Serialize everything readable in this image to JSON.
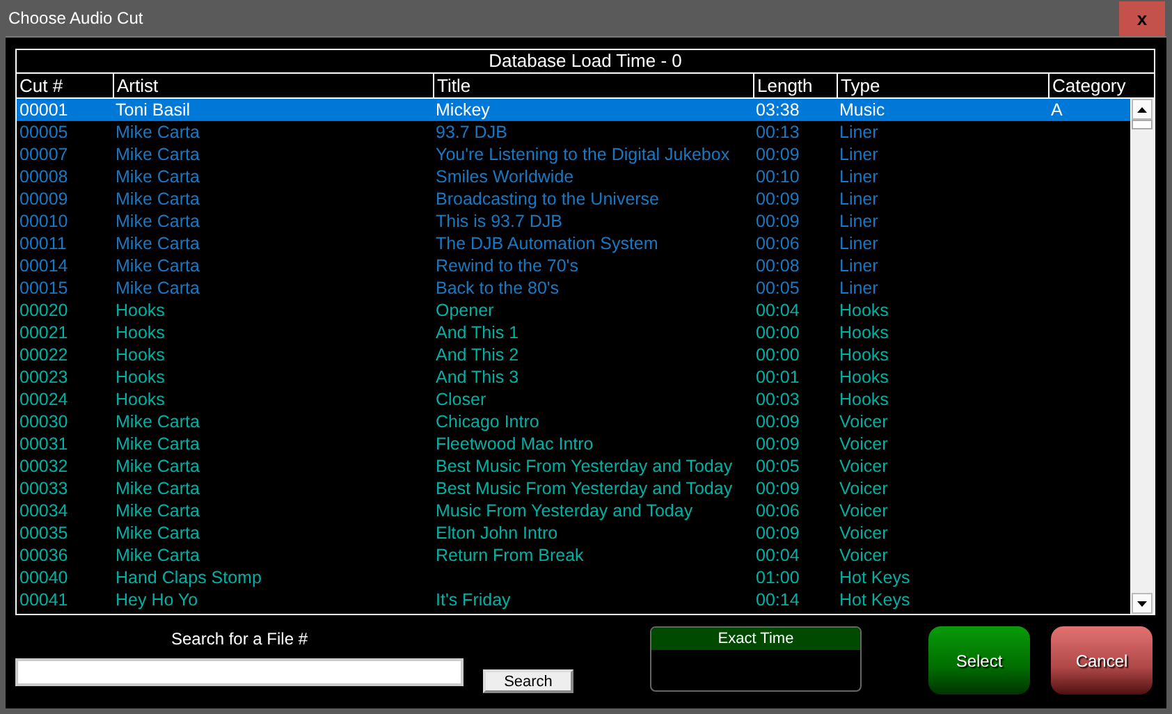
{
  "window": {
    "title": "Choose Audio Cut",
    "close": "x"
  },
  "table": {
    "caption": "Database Load Time - 0",
    "columns": [
      "Cut #",
      "Artist",
      "Title",
      "Length",
      "Type",
      "Category"
    ],
    "rows": [
      {
        "cells": [
          "00001",
          "Toni Basil",
          "Mickey",
          "03:38",
          "Music",
          "A"
        ],
        "selected": true
      },
      {
        "cells": [
          "00005",
          "Mike Carta",
          "93.7 DJB",
          "00:13",
          "Liner",
          ""
        ],
        "selected": false,
        "kind": "liner"
      },
      {
        "cells": [
          "00007",
          "Mike Carta",
          "You're Listening to the Digital Jukebox",
          "00:09",
          "Liner",
          ""
        ],
        "selected": false,
        "kind": "liner"
      },
      {
        "cells": [
          "00008",
          "Mike Carta",
          "Smiles Worldwide",
          "00:10",
          "Liner",
          ""
        ],
        "selected": false,
        "kind": "liner"
      },
      {
        "cells": [
          "00009",
          "Mike Carta",
          "Broadcasting to the Universe",
          "00:09",
          "Liner",
          ""
        ],
        "selected": false,
        "kind": "liner"
      },
      {
        "cells": [
          "00010",
          "Mike Carta",
          "This is 93.7 DJB",
          "00:09",
          "Liner",
          ""
        ],
        "selected": false,
        "kind": "liner"
      },
      {
        "cells": [
          "00011",
          "Mike Carta",
          "The DJB Automation System",
          "00:06",
          "Liner",
          ""
        ],
        "selected": false,
        "kind": "liner"
      },
      {
        "cells": [
          "00014",
          "Mike Carta",
          "Rewind to the 70's",
          "00:08",
          "Liner",
          ""
        ],
        "selected": false,
        "kind": "liner"
      },
      {
        "cells": [
          "00015",
          "Mike Carta",
          "Back to the 80's",
          "00:05",
          "Liner",
          ""
        ],
        "selected": false,
        "kind": "liner"
      },
      {
        "cells": [
          "00020",
          "Hooks",
          "Opener",
          "00:04",
          "Hooks",
          ""
        ],
        "selected": false,
        "kind": "other"
      },
      {
        "cells": [
          "00021",
          "Hooks",
          "And This 1",
          "00:00",
          "Hooks",
          ""
        ],
        "selected": false,
        "kind": "other"
      },
      {
        "cells": [
          "00022",
          "Hooks",
          "And This 2",
          "00:00",
          "Hooks",
          ""
        ],
        "selected": false,
        "kind": "other"
      },
      {
        "cells": [
          "00023",
          "Hooks",
          "And This 3",
          "00:01",
          "Hooks",
          ""
        ],
        "selected": false,
        "kind": "other"
      },
      {
        "cells": [
          "00024",
          "Hooks",
          "Closer",
          "00:03",
          "Hooks",
          ""
        ],
        "selected": false,
        "kind": "other"
      },
      {
        "cells": [
          "00030",
          "Mike Carta",
          "Chicago Intro",
          "00:09",
          "Voicer",
          ""
        ],
        "selected": false,
        "kind": "other"
      },
      {
        "cells": [
          "00031",
          "Mike Carta",
          "Fleetwood Mac Intro",
          "00:09",
          "Voicer",
          ""
        ],
        "selected": false,
        "kind": "other"
      },
      {
        "cells": [
          "00032",
          "Mike Carta",
          "Best Music From Yesterday and Today",
          "00:05",
          "Voicer",
          ""
        ],
        "selected": false,
        "kind": "other"
      },
      {
        "cells": [
          "00033",
          "Mike Carta",
          "Best Music From Yesterday and Today",
          "00:09",
          "Voicer",
          ""
        ],
        "selected": false,
        "kind": "other"
      },
      {
        "cells": [
          "00034",
          "Mike Carta",
          "Music From Yesterday and Today",
          "00:06",
          "Voicer",
          ""
        ],
        "selected": false,
        "kind": "other"
      },
      {
        "cells": [
          "00035",
          "Mike Carta",
          "Elton John Intro",
          "00:09",
          "Voicer",
          ""
        ],
        "selected": false,
        "kind": "other"
      },
      {
        "cells": [
          "00036",
          "Mike Carta",
          "Return From Break",
          "00:04",
          "Voicer",
          ""
        ],
        "selected": false,
        "kind": "other"
      },
      {
        "cells": [
          "00040",
          "Hand Claps Stomp",
          "",
          "01:00",
          "Hot Keys",
          ""
        ],
        "selected": false,
        "kind": "other"
      },
      {
        "cells": [
          "00041",
          "Hey Ho Yo",
          "It's Friday",
          "00:14",
          "Hot Keys",
          ""
        ],
        "selected": false,
        "kind": "other"
      }
    ]
  },
  "search": {
    "label": "Search for a File #",
    "button": "Search"
  },
  "exact_time": {
    "title": "Exact Time"
  },
  "buttons": [
    "Select",
    "Cancel"
  ]
}
